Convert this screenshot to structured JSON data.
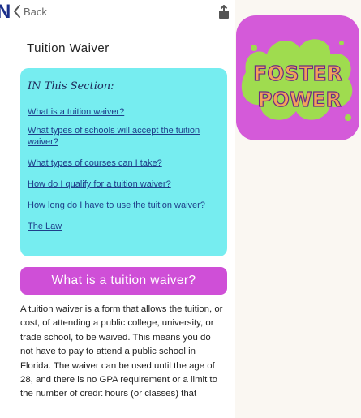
{
  "nav": {
    "back_label": "Back"
  },
  "corner_logo_letter": "N",
  "page": {
    "title": "Tuition Waiver",
    "toc_heading": "IN This Section:",
    "toc_links": [
      "What is a tuition waiver?",
      "What types of schools will accept the tuition waiver?",
      "What types of courses can I take?",
      "How do I qualify for a tuition waiver?",
      "How long do I have to use the tuition waiver?",
      "The Law"
    ],
    "section_header": "What is a tuition waiver?",
    "body_paragraph": "A tuition waiver is a form that allows the tuition, or cost, of attending a public college, university, or trade school, to be waived. This means you do not have to pay to attend a public school in Florida. The waiver can be used until the age of 28, and there is no GPA requirement or a limit to the number of credit hours (or classes) that"
  },
  "app_icon": {
    "line1": "FOSTER",
    "line2": "POWER"
  },
  "colors": {
    "toc_bg": "#76edf0",
    "section_bar": "#cf4fd7",
    "app_icon_bg": "#d45ad9",
    "app_icon_splash": "#9fdc4f",
    "app_icon_text": "#f2a35a"
  },
  "icons": {
    "back": "chevron-left-icon",
    "share": "share-icon"
  }
}
